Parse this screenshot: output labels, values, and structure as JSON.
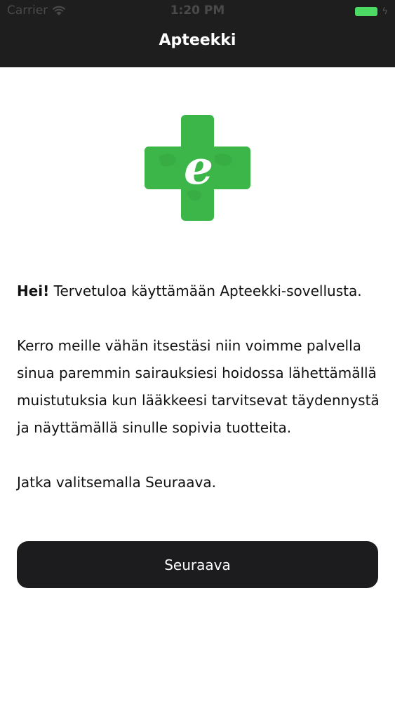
{
  "status_bar": {
    "carrier": "Carrier",
    "time": "1:20 PM",
    "battery_color": "#4cd964"
  },
  "header": {
    "title": "Apteekki",
    "background": "#1f1e1f"
  },
  "logo": {
    "icon": "green-cross-e-logo",
    "letter": "e",
    "color": "#3cb648"
  },
  "content": {
    "greeting_bold": "Hei!",
    "greeting_rest": " Tervetuloa käyttämään Apteekki-sovellusta.",
    "description": "Kerro meille vähän itsestäsi niin voimme palvella sinua paremmin sairauksiesi hoidossa lähettämällä muistutuksia kun lääkkeesi tarvitsevat täydennystä ja näyttämällä sinulle sopivia tuotteita.",
    "instruction": "Jatka valitsemalla Seuraava."
  },
  "actions": {
    "next_label": "Seuraava"
  }
}
